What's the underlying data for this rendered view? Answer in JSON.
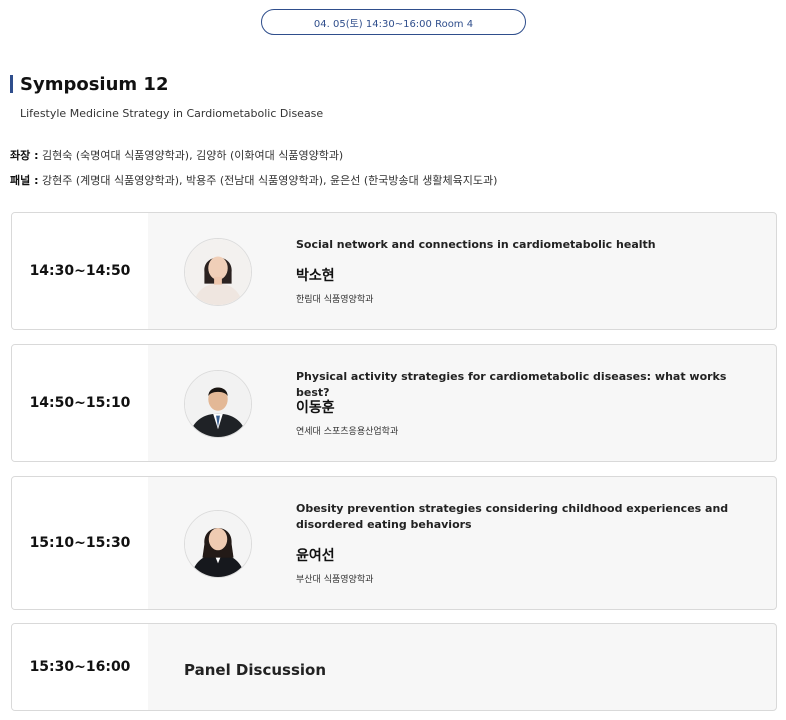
{
  "header": {
    "date_time_room": "04. 05(토) 14:30~16:00 Room 4"
  },
  "symposium": {
    "title": "Symposium 12",
    "subtitle": "Lifestyle Medicine Strategy in Cardiometabolic Disease",
    "accent_color": "#2f4e8c"
  },
  "chairs": {
    "label": "좌장 :",
    "names": " 김현숙 (숙명여대 식품영양학과), 김양하 (이화여대 식품영양학과)"
  },
  "panel": {
    "label": "패널 :",
    "names": " 강현주 (계명대 식품영양학과), 박용주 (전남대 식품영양학과), 윤은선 (한국방송대 생활체육지도과)"
  },
  "sessions": [
    {
      "time": "14:30~14:50",
      "title": "Social network and connections in cardiometabolic health",
      "speaker": "박소현",
      "affiliation": "한림대 식품영양학과",
      "photo_icon": "speaker-photo-icon"
    },
    {
      "time": "14:50~15:10",
      "title": "Physical activity strategies for cardiometabolic diseases: what works best?",
      "speaker": "이동훈",
      "affiliation": "연세대 스포츠응용산업학과",
      "photo_icon": "speaker-photo-icon"
    },
    {
      "time": "15:10~15:30",
      "title": "Obesity prevention strategies considering childhood experiences and disordered eating behaviors",
      "speaker": "윤여선",
      "affiliation": "부산대 식품영양학과",
      "photo_icon": "speaker-photo-icon"
    },
    {
      "time": "15:30~16:00",
      "title": "Panel Discussion"
    }
  ]
}
